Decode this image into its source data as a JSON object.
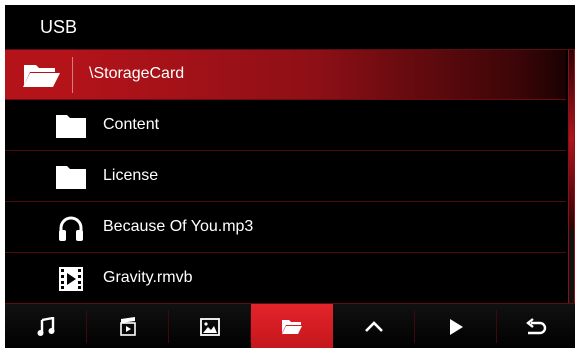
{
  "header": {
    "title": "USB"
  },
  "path": {
    "label": "\\StorageCard",
    "icon": "open-folder-icon"
  },
  "items": [
    {
      "label": "Content",
      "icon": "folder-icon"
    },
    {
      "label": "License",
      "icon": "folder-icon"
    },
    {
      "label": "Because Of You.mp3",
      "icon": "headphones-icon"
    },
    {
      "label": "Gravity.rmvb",
      "icon": "film-icon"
    }
  ],
  "toolbar": {
    "buttons": [
      {
        "icon": "music-note-icon"
      },
      {
        "icon": "video-icon"
      },
      {
        "icon": "photo-icon"
      },
      {
        "icon": "folder-icon",
        "active": true
      },
      {
        "icon": "chevron-up-icon"
      },
      {
        "icon": "play-icon"
      },
      {
        "icon": "back-arrow-icon"
      }
    ]
  },
  "colors": {
    "accent": "#c3161c",
    "background": "#000000",
    "text": "#ffffff"
  }
}
